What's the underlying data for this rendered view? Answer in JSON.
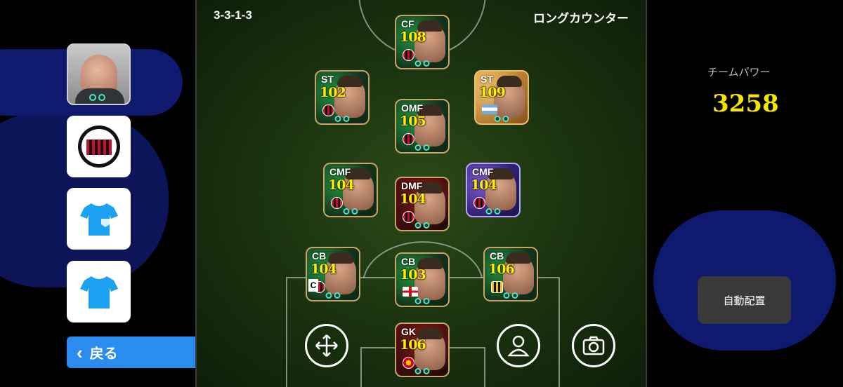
{
  "formation": "3-3-1-3",
  "playstyle": "ロングカウンター",
  "team_power": {
    "label": "チームパワー",
    "value": "3258"
  },
  "auto_arrange_label": "自動配置",
  "back_label": "戻る",
  "players": [
    {
      "slot": "cf",
      "pos": "CF",
      "ovr": "108",
      "club": "milan"
    },
    {
      "slot": "st-left",
      "pos": "ST",
      "ovr": "102",
      "club": "milan"
    },
    {
      "slot": "omf",
      "pos": "OMF",
      "ovr": "105",
      "club": "milan"
    },
    {
      "slot": "st-right",
      "pos": "ST",
      "ovr": "109",
      "club": "argentina"
    },
    {
      "slot": "cmf-left",
      "pos": "CMF",
      "ovr": "104",
      "club": "milan"
    },
    {
      "slot": "dmf",
      "pos": "DMF",
      "ovr": "104",
      "club": "milan"
    },
    {
      "slot": "cmf-right",
      "pos": "CMF",
      "ovr": "104",
      "club": "milan"
    },
    {
      "slot": "cb-left",
      "pos": "CB",
      "ovr": "104",
      "club": "milan",
      "captain": "C"
    },
    {
      "slot": "cb-center",
      "pos": "CB",
      "ovr": "103",
      "club": "england"
    },
    {
      "slot": "cb-right",
      "pos": "CB",
      "ovr": "106",
      "club": "juventus"
    },
    {
      "slot": "gk",
      "pos": "GK",
      "ovr": "106",
      "club": "man-utd"
    }
  ],
  "icons": {
    "move": "move-arrows-icon",
    "player": "person-icon",
    "camera": "camera-icon",
    "kit": "shirt-icon",
    "back": "chevron-left-icon"
  },
  "colors": {
    "accent": "#2b8cf0",
    "power": "#f4e400"
  }
}
